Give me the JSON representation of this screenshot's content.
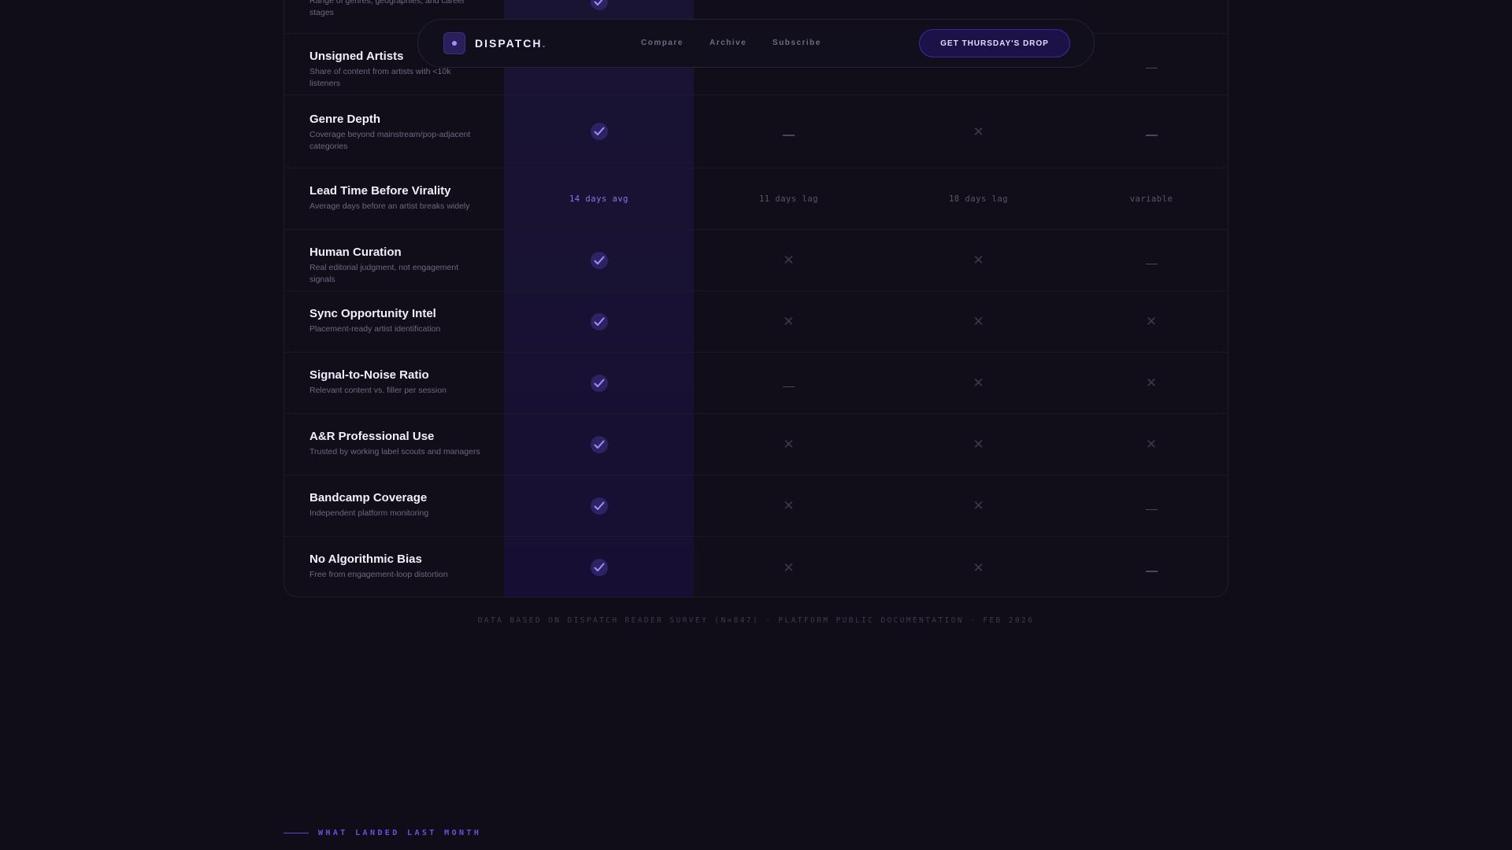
{
  "nav": {
    "brand": "DISPATCH",
    "brand_suffix": ".",
    "links": [
      "Compare",
      "Archive",
      "Subscribe"
    ],
    "cta": "GET THURSDAY'S DROP"
  },
  "table": {
    "rows": [
      {
        "title": "",
        "desc": "Range of genres, geographies, and career stages",
        "values": [
          "check",
          "",
          "",
          ""
        ]
      },
      {
        "title": "Unsigned Artists",
        "desc": "Share of content from artists with <10k listeners",
        "values": [
          "",
          "",
          "",
          "dash"
        ]
      },
      {
        "title": "Genre Depth",
        "desc": "Coverage beyond mainstream/pop-adjacent categories",
        "values": [
          "check",
          "dash",
          "x",
          "dash"
        ]
      },
      {
        "title": "Lead Time Before Virality",
        "desc": "Average days before an artist breaks widely",
        "values": [
          "14 days avg",
          "11 days lag",
          "18 days lag",
          "variable"
        ]
      },
      {
        "title": "Human Curation",
        "desc": "Real editorial judgment, not engagement signals",
        "values": [
          "check",
          "x",
          "x",
          "dash"
        ]
      },
      {
        "title": "Sync Opportunity Intel",
        "desc": "Placement-ready artist identification",
        "values": [
          "check",
          "x",
          "x",
          "x"
        ]
      },
      {
        "title": "Signal-to-Noise Ratio",
        "desc": "Relevant content vs. filler per session",
        "values": [
          "check",
          "dash",
          "x",
          "x"
        ]
      },
      {
        "title": "A&R Professional Use",
        "desc": "Trusted by working label scouts and managers",
        "values": [
          "check",
          "x",
          "x",
          "x"
        ]
      },
      {
        "title": "Bandcamp Coverage",
        "desc": "Independent platform monitoring",
        "values": [
          "check",
          "x",
          "x",
          "dash"
        ]
      },
      {
        "title": "No Algorithmic Bias",
        "desc": "Free from engagement-loop distortion",
        "values": [
          "check",
          "x",
          "x",
          "dash"
        ]
      }
    ]
  },
  "footnote": "DATA BASED ON DISPATCH READER SURVEY (N=847) · PLATFORM PUBLIC DOCUMENTATION · FEB 2026",
  "section_label": "WHAT LANDED LAST MONTH",
  "colors": {
    "accent": "#7a5cf0",
    "background": "#100d19",
    "highlight_column": "#1a1433"
  }
}
